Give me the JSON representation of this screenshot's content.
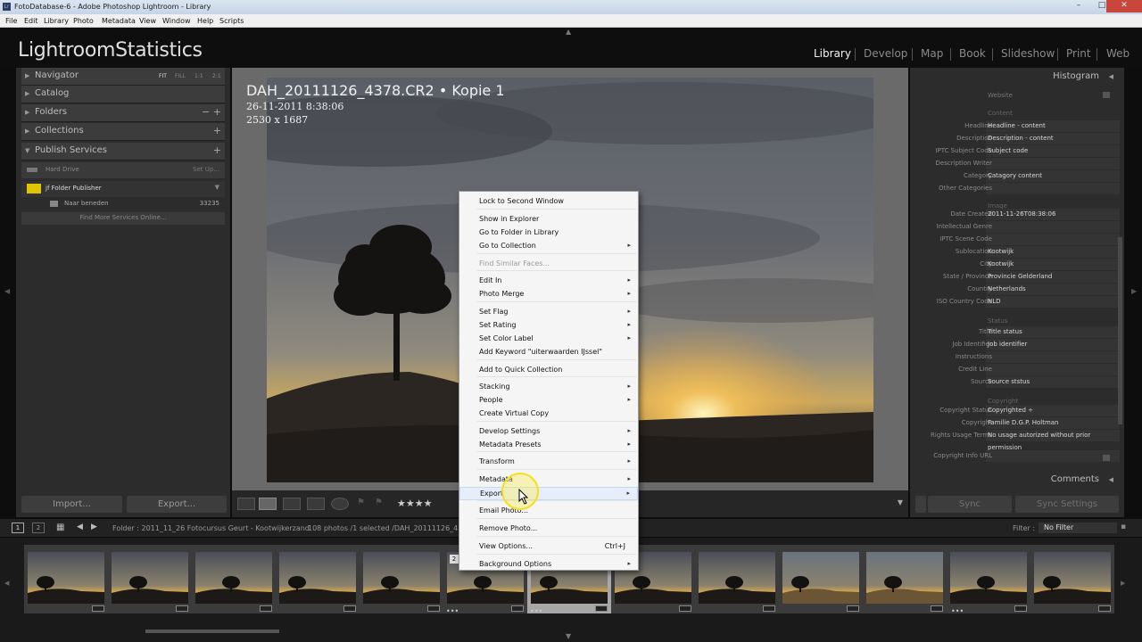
{
  "window": {
    "title": "FotoDatabase-6 - Adobe Photoshop Lightroom - Library",
    "app_icon": "Lr",
    "minimize": "–",
    "maximize": "□",
    "close": "✕"
  },
  "menu": [
    "File",
    "Edit",
    "Library",
    "Photo",
    "Metadata",
    "View",
    "Window",
    "Help",
    "Scripts"
  ],
  "identity_plate": "LightroomStatistics",
  "modules": [
    "Library",
    "Develop",
    "Map",
    "Book",
    "Slideshow",
    "Print",
    "Web"
  ],
  "active_module": "Library",
  "left_panel": {
    "navigator": {
      "label": "Navigator",
      "zoom": [
        "FIT",
        "FILL",
        "1:1",
        "2:1"
      ]
    },
    "catalog": "Catalog",
    "folders": {
      "label": "Folders",
      "actions": "− +"
    },
    "collections": {
      "label": "Collections",
      "action": "+"
    },
    "publish": {
      "label": "Publish Services",
      "action": "+",
      "hard_drive": "Hard Drive",
      "setup": "Set Up...",
      "jf_publisher": "jf Folder Publisher",
      "naar_beneden": "Naar beneden",
      "count": "33235",
      "find_more": "Find More Services Online..."
    },
    "import_label": "Import...",
    "export_label": "Export..."
  },
  "photo_overlay": {
    "title": "DAH_20111126_4378.CR2 • Kopie 1",
    "date": "26-11-2011 8:38:06",
    "dimensions": "2530 x 1687"
  },
  "context_menu": [
    {
      "label": "Lock to Second Window"
    },
    {
      "label": "Show in Explorer"
    },
    {
      "label": "Go to Folder in Library"
    },
    {
      "label": "Go to Collection",
      "submenu": true
    },
    {
      "label": "Find Similar Faces...",
      "disabled": true
    },
    {
      "label": "Edit In",
      "submenu": true
    },
    {
      "label": "Photo Merge",
      "submenu": true
    },
    {
      "label": "Set Flag",
      "submenu": true
    },
    {
      "label": "Set Rating",
      "submenu": true
    },
    {
      "label": "Set Color Label",
      "submenu": true
    },
    {
      "label": "Add Keyword \"uiterwaarden IJssel\""
    },
    {
      "label": "Add to Quick Collection"
    },
    {
      "label": "Stacking",
      "submenu": true
    },
    {
      "label": "People",
      "submenu": true
    },
    {
      "label": "Create Virtual Copy"
    },
    {
      "label": "Develop Settings",
      "submenu": true
    },
    {
      "label": "Metadata Presets",
      "submenu": true
    },
    {
      "label": "Transform",
      "submenu": true
    },
    {
      "label": "Metadata",
      "submenu": true
    },
    {
      "label": "Export",
      "submenu": true,
      "highlighted": true
    },
    {
      "label": "Email Photo..."
    },
    {
      "label": "Remove Photo..."
    },
    {
      "label": "View Options...",
      "shortcut": "Ctrl+J"
    },
    {
      "label": "Background Options",
      "submenu": true
    }
  ],
  "submenu_arrow": "▸",
  "right_panel": {
    "histogram": "Histogram",
    "website_label": "Website",
    "content_section": "Content",
    "fields_content": [
      {
        "label": "Headline",
        "value": "Headline - content"
      },
      {
        "label": "Description",
        "value": "Description - content"
      },
      {
        "label": "IPTC Subject Code",
        "value": "Subject code"
      },
      {
        "label": "Description Writer",
        "value": ""
      },
      {
        "label": "Category",
        "value": "Catagory content"
      },
      {
        "label": "Other Categories",
        "value": ""
      }
    ],
    "image_section": "Image",
    "fields_image": [
      {
        "label": "Date Created",
        "value": "2011-11-26T08:38:06"
      },
      {
        "label": "Intellectual Genre",
        "value": ""
      },
      {
        "label": "IPTC Scene Code",
        "value": ""
      },
      {
        "label": "Sublocation",
        "value": "Kootwijk"
      },
      {
        "label": "City",
        "value": "Kootwijk"
      },
      {
        "label": "State / Province",
        "value": "Provincie Gelderland"
      },
      {
        "label": "Country",
        "value": "Netherlands"
      },
      {
        "label": "ISO Country Code",
        "value": "NLD"
      }
    ],
    "status_section": "Status",
    "fields_status": [
      {
        "label": "Title",
        "value": "Title status"
      },
      {
        "label": "Job Identifier",
        "value": "Job identifier"
      },
      {
        "label": "Instructions",
        "value": ""
      },
      {
        "label": "Credit Line",
        "value": ""
      },
      {
        "label": "Source",
        "value": "Source ststus"
      }
    ],
    "copyright_section": "Copyright",
    "fields_copyright": [
      {
        "label": "Copyright Status",
        "value": "Copyrighted ÷"
      },
      {
        "label": "Copyright",
        "value": "Familie D.G.P. Holtman"
      },
      {
        "label": "Rights Usage Terms",
        "value": "No usage autorized without prior"
      },
      {
        "label": "",
        "value": "permission"
      },
      {
        "label": "Copyright Info URL",
        "value": ""
      }
    ],
    "comments": "Comments",
    "sync": "Sync",
    "sync_settings": "Sync Settings"
  },
  "filmstrip_bar": {
    "pages": [
      "1",
      "2"
    ],
    "folder_text": "Folder : 2011_11_26 Fotocursus Geurt - Kootwijkerzand",
    "count_text": "108 photos /1 selected /DAH_20111126_437",
    "filter_label": "Filter :",
    "filter_value": "No Filter"
  },
  "thumb_badge": "2",
  "rating": "★★★★",
  "colors": {
    "background": "#0d0d0d",
    "panel": "#2c2c2c",
    "menu_bg": "#f5f5f5",
    "accent_cursor": "#f2e023"
  }
}
